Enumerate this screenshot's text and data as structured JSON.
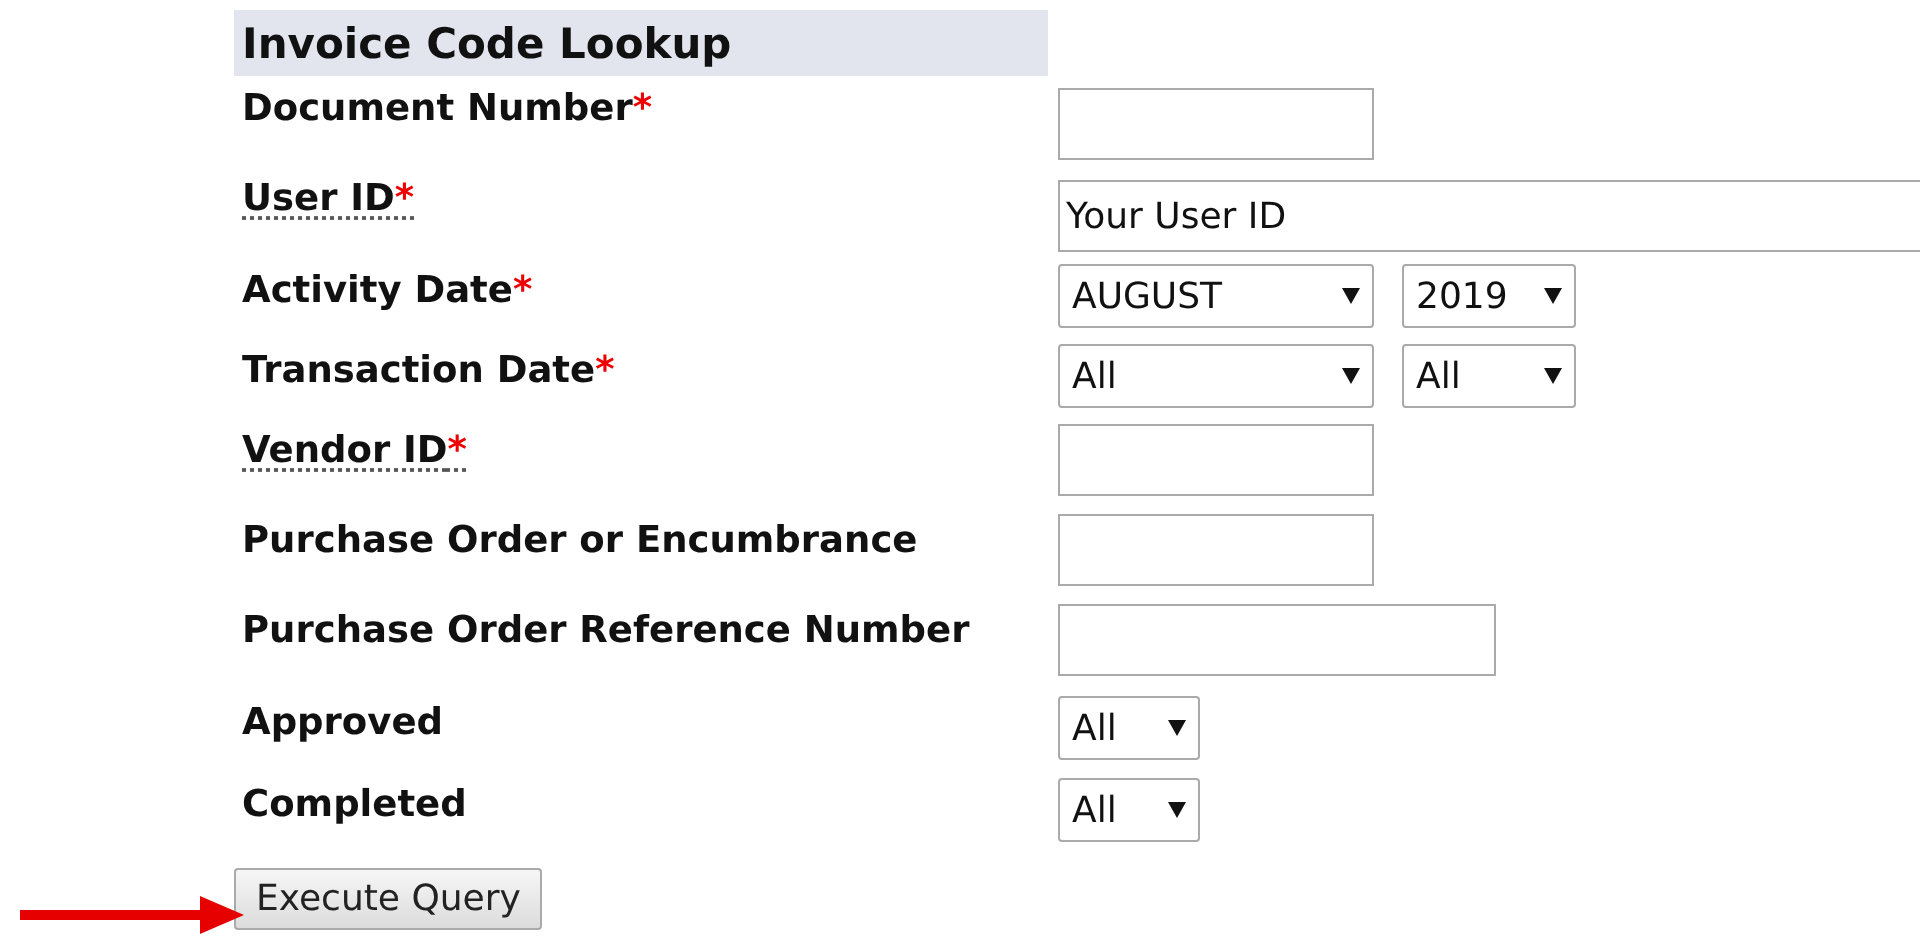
{
  "title": "Invoice Code Lookup",
  "fields": [
    {
      "label": "Document Number",
      "required": true,
      "dotted": false,
      "controls": [
        {
          "kind": "text"
        }
      ]
    },
    {
      "label": "User ID",
      "required": true,
      "dotted": true,
      "controls": [
        {
          "kind": "text",
          "value": "Your User ID"
        }
      ]
    },
    {
      "label": "Activity Date",
      "required": true,
      "dotted": false,
      "controls": [
        {
          "kind": "select",
          "value": "AUGUST"
        },
        {
          "kind": "select",
          "value": "2019"
        }
      ]
    },
    {
      "label": "Transaction Date",
      "required": true,
      "dotted": false,
      "controls": [
        {
          "kind": "select",
          "value": "All"
        },
        {
          "kind": "select",
          "value": "All"
        }
      ]
    },
    {
      "label": "Vendor ID",
      "required": true,
      "dotted": true,
      "controls": [
        {
          "kind": "text"
        }
      ]
    },
    {
      "label": "Purchase Order or Encumbrance",
      "required": false,
      "dotted": false,
      "controls": [
        {
          "kind": "text"
        }
      ]
    },
    {
      "label": "Purchase Order Reference Number",
      "required": false,
      "dotted": false,
      "controls": [
        {
          "kind": "text"
        }
      ]
    },
    {
      "label": "Approved",
      "required": false,
      "dotted": false,
      "controls": [
        {
          "kind": "select",
          "value": "All"
        }
      ]
    },
    {
      "label": "Completed",
      "required": false,
      "dotted": false,
      "controls": [
        {
          "kind": "select",
          "value": "All"
        }
      ]
    }
  ],
  "required_mark": "*",
  "submit": "Execute Query"
}
